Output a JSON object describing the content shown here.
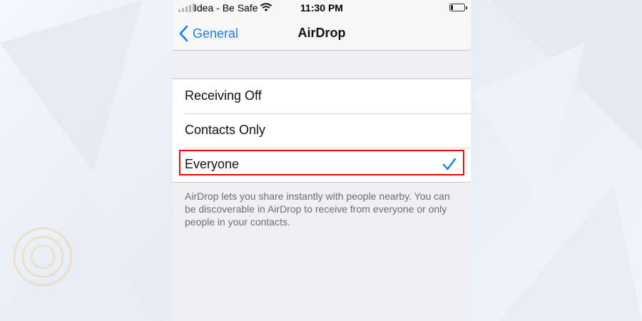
{
  "status_bar": {
    "carrier": "Idea - Be Safe",
    "time": "11:30 PM",
    "signal_icon": "signal-bars-icon",
    "wifi_icon": "wifi-icon",
    "battery_icon": "battery-icon",
    "battery_level": 0.15
  },
  "nav": {
    "back_label": "General",
    "back_icon": "chevron-left-icon",
    "title": "AirDrop"
  },
  "options": [
    {
      "label": "Receiving Off",
      "selected": false
    },
    {
      "label": "Contacts Only",
      "selected": false
    },
    {
      "label": "Everyone",
      "selected": true
    }
  ],
  "footer": {
    "description": "AirDrop lets you share instantly with people nearby. You can be discoverable in AirDrop to receive from everyone or only people in your contacts."
  },
  "colors": {
    "accent": "#1a7cf4",
    "highlight_border": "#e5080c",
    "group_background": "#efeff4"
  }
}
